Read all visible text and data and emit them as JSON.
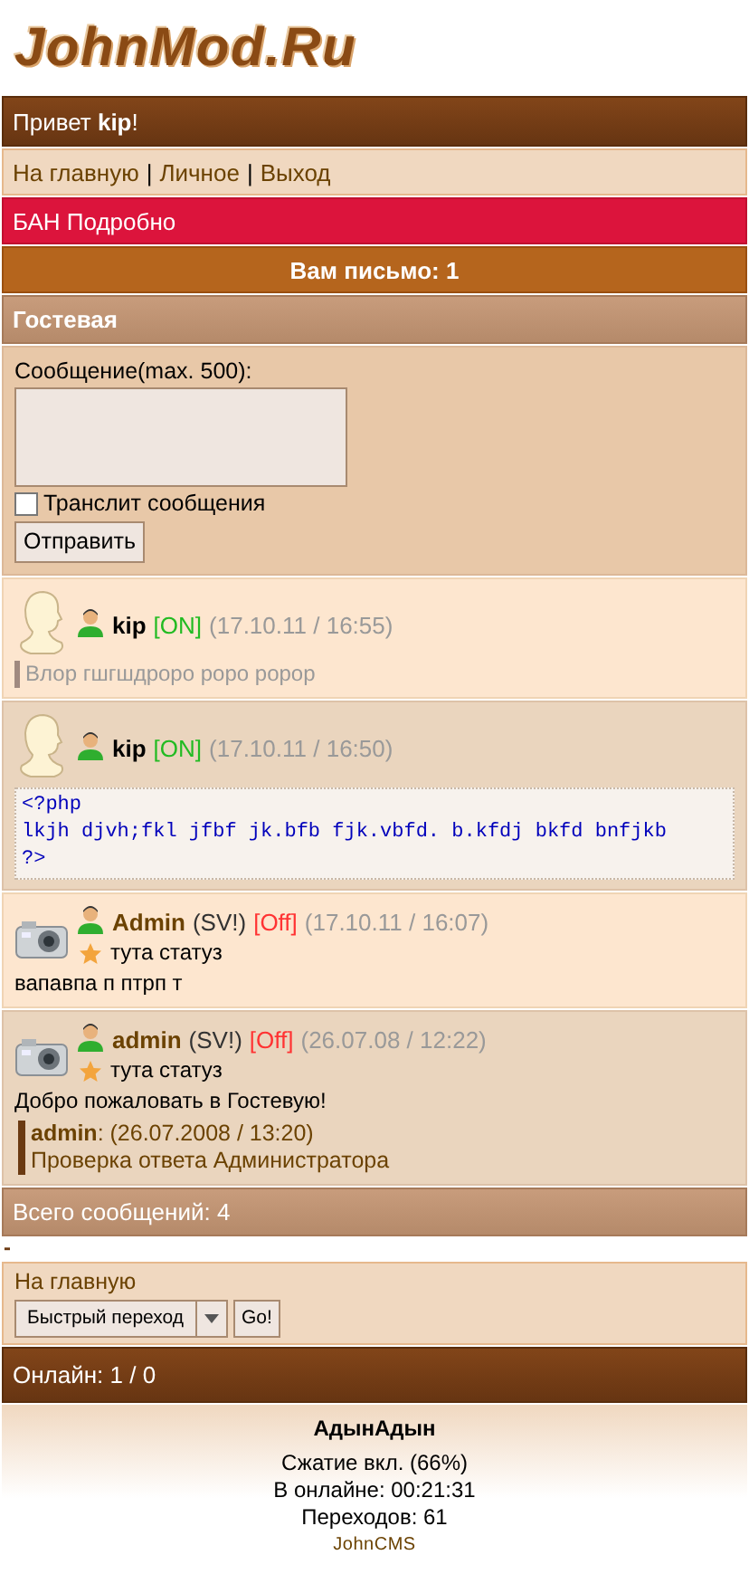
{
  "logo": "JohnMod.Ru",
  "greeting": "Привет **kip**!",
  "nav": [
    {
      "label": "На главную"
    },
    {
      "label": "Личное"
    },
    {
      "label": "Выход"
    }
  ],
  "nav_separator": "|",
  "ban": "БАН Подробно",
  "mail": "Вам письмо: 1",
  "section_title": "Гостевая",
  "form": {
    "label": "Сообщение(max. 500):",
    "translit": {
      "label": "Транслит сообщения",
      "checked": false
    },
    "submit": "Отправить"
  },
  "posts": [
    {
      "kind": "person",
      "name": "kip",
      "admin": false,
      "online": true,
      "online_label": "[ON]",
      "time": "(17.10.11 / 16:55)",
      "body": {
        "kind": "quote",
        "text": "Влор гшгшдроро роро ророр"
      }
    },
    {
      "kind": "person",
      "name": "kip",
      "admin": false,
      "online": true,
      "online_label": "[ON]",
      "time": "(17.10.11 / 16:50)",
      "body": {
        "kind": "code",
        "lines": [
          "<?php",
          "lkjh djvh;fkl jfbf jk.bfb fjk.vbfd. b.kfdj bkfd bnfjkb",
          "?>"
        ]
      }
    },
    {
      "kind": "camera",
      "name": "Admin",
      "admin": true,
      "rank": "(SV!)",
      "online": false,
      "online_label": "[Off]",
      "time": "(17.10.11 / 16:07)",
      "status": "тута статуз",
      "body": {
        "kind": "text",
        "text": "вапавпа п птрп т"
      }
    },
    {
      "kind": "camera",
      "name": "admin",
      "admin": true,
      "rank": "(SV!)",
      "online": false,
      "online_label": "[Off]",
      "time": "(26.07.08 / 12:22)",
      "status": "тута статуз",
      "body": {
        "kind": "text",
        "text": "Добро пожаловать в Гостевую!"
      },
      "reply": {
        "name": "admin",
        "time": ": (26.07.2008 / 13:20)",
        "text": "Проверка ответа Администратора"
      }
    }
  ],
  "total": "Всего сообщений: 4",
  "dash": "-",
  "footer_nav": {
    "link": "На главную",
    "select": "Быстрый переход",
    "go": "Go!"
  },
  "online": "Онлайн: 1 / 0",
  "footer": {
    "title": "АдынАдын",
    "lines": [
      "Сжатие вкл. (66%)",
      "В онлайне: 00:21:31",
      "Переходов: 61"
    ],
    "brand": "JohnCMS"
  }
}
